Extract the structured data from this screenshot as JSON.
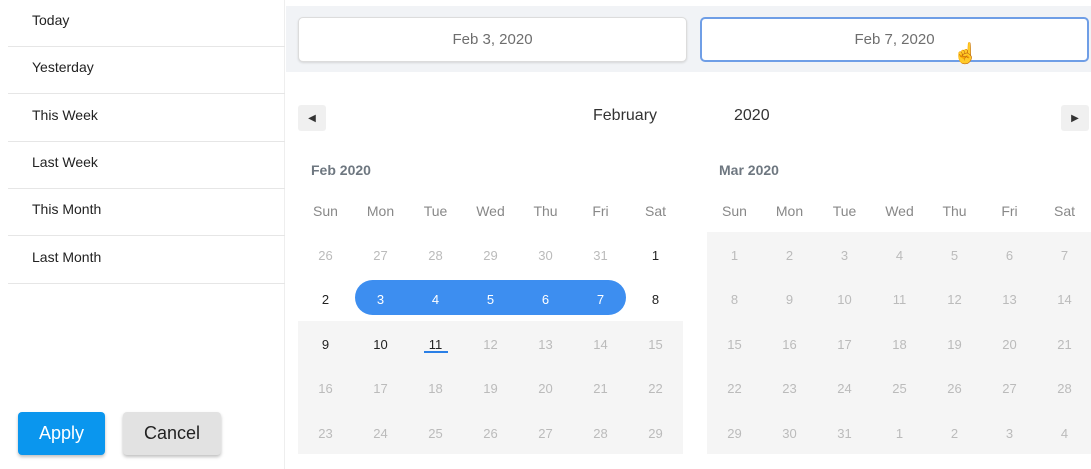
{
  "sidebar": {
    "presets": [
      "Today",
      "Yesterday",
      "This Week",
      "Last Week",
      "This Month",
      "Last Month"
    ],
    "apply_label": "Apply",
    "cancel_label": "Cancel"
  },
  "inputs": {
    "start_value": "Feb 3, 2020",
    "end_value": "Feb 7, 2020"
  },
  "header": {
    "month": "February",
    "year": "2020",
    "prev_icon": "triangle-left",
    "next_icon": "triangle-right"
  },
  "weekdays": [
    "Sun",
    "Mon",
    "Tue",
    "Wed",
    "Thu",
    "Fri",
    "Sat"
  ],
  "calendars": [
    {
      "title": "Feb 2020",
      "weeks": [
        [
          [
            "26",
            "muted"
          ],
          [
            "27",
            "muted"
          ],
          [
            "28",
            "muted"
          ],
          [
            "29",
            "muted"
          ],
          [
            "30",
            "muted"
          ],
          [
            "31",
            "muted"
          ],
          [
            "1",
            "active"
          ]
        ],
        [
          [
            "2",
            "active"
          ],
          [
            "3",
            "sel"
          ],
          [
            "4",
            "sel"
          ],
          [
            "5",
            "sel"
          ],
          [
            "6",
            "sel"
          ],
          [
            "7",
            "sel"
          ],
          [
            "8",
            "active"
          ]
        ],
        [
          [
            "9",
            "active"
          ],
          [
            "10",
            "active"
          ],
          [
            "11",
            "active"
          ],
          [
            "12",
            "muted"
          ],
          [
            "13",
            "muted"
          ],
          [
            "14",
            "muted"
          ],
          [
            "15",
            "muted"
          ]
        ],
        [
          [
            "16",
            "muted"
          ],
          [
            "17",
            "muted"
          ],
          [
            "18",
            "muted"
          ],
          [
            "19",
            "muted"
          ],
          [
            "20",
            "muted"
          ],
          [
            "21",
            "muted"
          ],
          [
            "22",
            "muted"
          ]
        ],
        [
          [
            "23",
            "muted"
          ],
          [
            "24",
            "muted"
          ],
          [
            "25",
            "muted"
          ],
          [
            "26",
            "muted"
          ],
          [
            "27",
            "muted"
          ],
          [
            "28",
            "muted"
          ],
          [
            "29",
            "muted"
          ]
        ]
      ]
    },
    {
      "title": "Mar 2020",
      "weeks": [
        [
          [
            "1",
            "muted"
          ],
          [
            "2",
            "muted"
          ],
          [
            "3",
            "muted"
          ],
          [
            "4",
            "muted"
          ],
          [
            "5",
            "muted"
          ],
          [
            "6",
            "muted"
          ],
          [
            "7",
            "muted"
          ]
        ],
        [
          [
            "8",
            "muted"
          ],
          [
            "9",
            "muted"
          ],
          [
            "10",
            "muted"
          ],
          [
            "11",
            "muted"
          ],
          [
            "12",
            "muted"
          ],
          [
            "13",
            "muted"
          ],
          [
            "14",
            "muted"
          ]
        ],
        [
          [
            "15",
            "muted"
          ],
          [
            "16",
            "muted"
          ],
          [
            "17",
            "muted"
          ],
          [
            "18",
            "muted"
          ],
          [
            "19",
            "muted"
          ],
          [
            "20",
            "muted"
          ],
          [
            "21",
            "muted"
          ]
        ],
        [
          [
            "22",
            "muted"
          ],
          [
            "23",
            "muted"
          ],
          [
            "24",
            "muted"
          ],
          [
            "25",
            "muted"
          ],
          [
            "26",
            "muted"
          ],
          [
            "27",
            "muted"
          ],
          [
            "28",
            "muted"
          ]
        ],
        [
          [
            "29",
            "muted"
          ],
          [
            "30",
            "muted"
          ],
          [
            "31",
            "muted"
          ],
          [
            "1",
            "muted"
          ],
          [
            "2",
            "muted"
          ],
          [
            "3",
            "muted"
          ],
          [
            "4",
            "muted"
          ]
        ]
      ]
    }
  ],
  "colors": {
    "accent": "#3d8ef0",
    "apply": "#0a96ee",
    "input_focus_border": "#6f9ee6"
  },
  "today_marker": "11"
}
